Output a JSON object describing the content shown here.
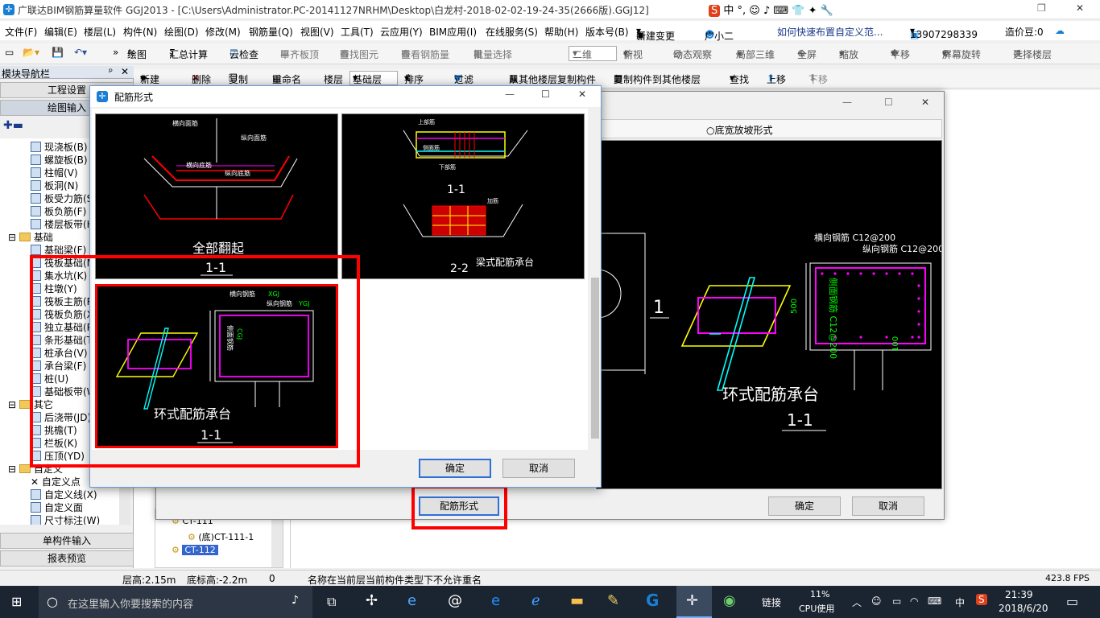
{
  "window": {
    "title": "广联达BIM钢筋算量软件 GGJ2013 - [C:\\Users\\Administrator.PC-20141127NRHM\\Desktop\\白龙村-2018-02-02-19-24-35(2666版).GGJ12]",
    "controls": [
      "—",
      "❐",
      "✕"
    ]
  },
  "menu": [
    "文件(F)",
    "编辑(E)",
    "楼层(L)",
    "构件(N)",
    "绘图(D)",
    "修改(M)",
    "钢筋量(Q)",
    "视图(V)",
    "工具(T)",
    "云应用(Y)",
    "BIM应用(I)",
    "在线服务(S)",
    "帮助(H)",
    "版本号(B)",
    "新建变更",
    "广小二",
    "如何快速布置自定义范...",
    "13907298339",
    "造价豆:0"
  ],
  "toolbar1": [
    "绘图",
    "汇总计算",
    "云检查",
    "平齐板顶",
    "查找图元",
    "查看钢筋量",
    "批量选择",
    "二维",
    "俯视",
    "动态观察",
    "局部三维",
    "全屏",
    "缩放",
    "平移",
    "屏幕旋转",
    "选择楼层"
  ],
  "toolbar2": [
    "新建",
    "删除",
    "复制",
    "重命名",
    "楼层",
    "基础层",
    "排序",
    "过滤",
    "从其他楼层复制构件",
    "复制构件到其他楼层",
    "查找",
    "上移",
    "下移"
  ],
  "nav": {
    "title": "模块导航栏",
    "btn_settings": "工程设置",
    "btn_draw": "绘图输入",
    "btn_single": "单构件输入",
    "btn_report": "报表预览",
    "items": [
      "现浇板(B)",
      "螺旋板(B)",
      "柱帽(V)",
      "板洞(N)",
      "板受力筋(S)",
      "板负筋(F)",
      "楼层板带(H)",
      "基础",
      "基础梁(F)",
      "筏板基础(M)",
      "集水坑(K)",
      "柱墩(Y)",
      "筏板主筋(R)",
      "筏板负筋(X)",
      "独立基础(P)",
      "条形基础(T)",
      "桩承台(V)",
      "承台梁(F)",
      "桩(U)",
      "基础板带(W)",
      "其它",
      "后浇带(JD)",
      "挑檐(T)",
      "栏板(K)",
      "压顶(YD)",
      "自定义",
      "自定义点",
      "自定义线(X)",
      "自定义面",
      "尺寸标注(W)"
    ]
  },
  "small_tree": [
    "CT-111",
    "(底)CT-111-1",
    "CT-112"
  ],
  "status": [
    "层高:2.15m",
    "底标高:-2.2m",
    "0",
    "名称在当前层当前构件类型下不允许重名",
    "423.8 FPS"
  ],
  "dialog_rebar": {
    "title": "配筋形式",
    "ok": "确定",
    "cancel": "取消",
    "panel1": {
      "caption": "全部翻起",
      "sub": "1-1",
      "labels": [
        "横向面筋",
        "纵向面筋",
        "横向底筋",
        "纵向底筋"
      ]
    },
    "panel2": {
      "caption": "梁式配筋承台",
      "sub1": "1-1",
      "sub2": "2-2",
      "labels": [
        "上部筋",
        "侧面筋",
        "下部筋",
        "加筋"
      ]
    },
    "panel3": {
      "caption": "环式配筋承台",
      "sub": "1-1",
      "labels": [
        "横向钢筋",
        "纵向钢筋",
        "侧面钢筋",
        "CGJ",
        "XGJ",
        "YGJ"
      ]
    }
  },
  "dialog_back": {
    "radio_label": "底宽放坡形式",
    "caption": "环式配筋承台",
    "sub": "1-1",
    "label_h": "横向钢筋 C12@200",
    "label_v": "纵向钢筋 C12@200",
    "label_side": "侧面钢筋 C12@200",
    "dim_500": "500",
    "dim_100": "100",
    "marker": "1",
    "ok": "确定",
    "cancel": "取消"
  },
  "btn_rebar_form": "配筋形式",
  "taskbar": {
    "search": "在这里输入你要搜索的内容",
    "cpu": "11%",
    "cpu_label": "CPU使用",
    "link": "链接",
    "ime": "中",
    "time": "21:39",
    "date": "2018/6/20"
  },
  "colors": {
    "highlight": "#ff0000",
    "accent": "#2f6fd6"
  }
}
